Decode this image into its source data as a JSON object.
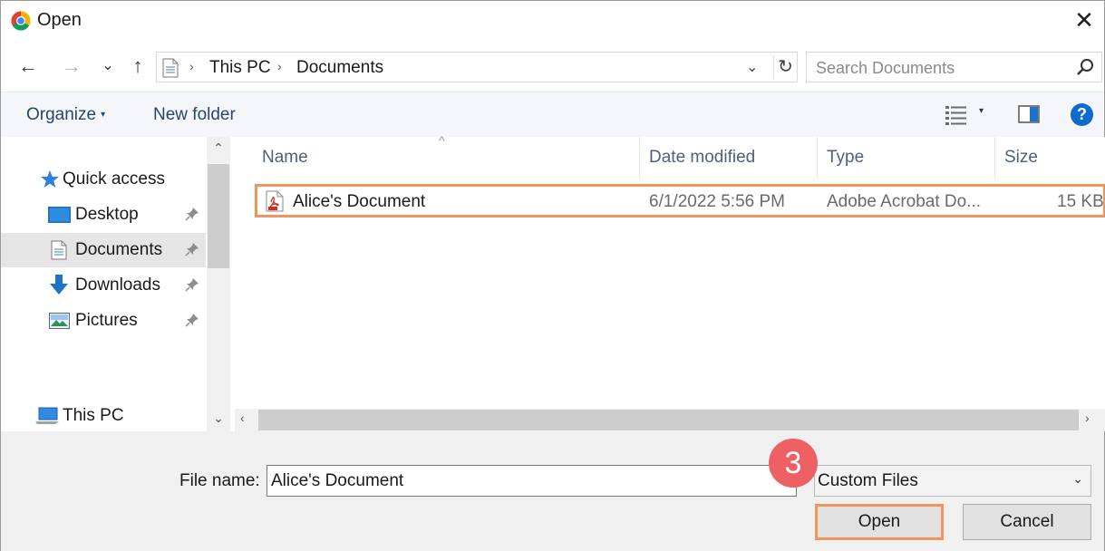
{
  "window": {
    "title": "Open",
    "app_icon": "chrome-icon",
    "close_glyph": "✕"
  },
  "nav": {
    "back": "←",
    "forward": "→",
    "recent": "⌄",
    "up": "↑"
  },
  "address": {
    "crumbs": [
      "This PC",
      "Documents"
    ],
    "separator": "›",
    "dropdown": "⌄",
    "refresh": "↻"
  },
  "search": {
    "placeholder": "Search Documents"
  },
  "commandbar": {
    "organize": "Organize",
    "organize_caret": "▾",
    "new_folder": "New folder",
    "view_caret": "▾",
    "help": "?"
  },
  "sidebar": {
    "items": [
      {
        "label": "Quick access",
        "icon": "star-icon"
      },
      {
        "label": "Desktop",
        "icon": "desktop-icon",
        "pinned": true
      },
      {
        "label": "Documents",
        "icon": "documents-icon",
        "pinned": true,
        "selected": true
      },
      {
        "label": "Downloads",
        "icon": "downloads-icon",
        "pinned": true
      },
      {
        "label": "Pictures",
        "icon": "pictures-icon",
        "pinned": true
      },
      {
        "label": "This PC",
        "icon": "computer-icon"
      }
    ],
    "pin_glyph": "📌",
    "scroll_up": "⌃",
    "scroll_down": "⌄"
  },
  "file_list": {
    "sort_indicator": "^",
    "columns": [
      "Name",
      "Date modified",
      "Type",
      "Size"
    ],
    "rows": [
      {
        "name": "Alice's Document",
        "date_modified": "6/1/2022 5:56 PM",
        "type": "Adobe Acrobat Do...",
        "size": "15 KB",
        "icon": "pdf-icon"
      }
    ],
    "scroll_left": "‹",
    "scroll_right": "›"
  },
  "bottom": {
    "file_name_label": "File name:",
    "file_name_value": "Alice's Document",
    "file_type": "Custom Files",
    "file_type_chevron": "⌄",
    "open_label": "Open",
    "cancel_label": "Cancel"
  },
  "annotation": {
    "step": "3",
    "highlight_color": "#f0955c",
    "badge_color": "#ed6165"
  }
}
